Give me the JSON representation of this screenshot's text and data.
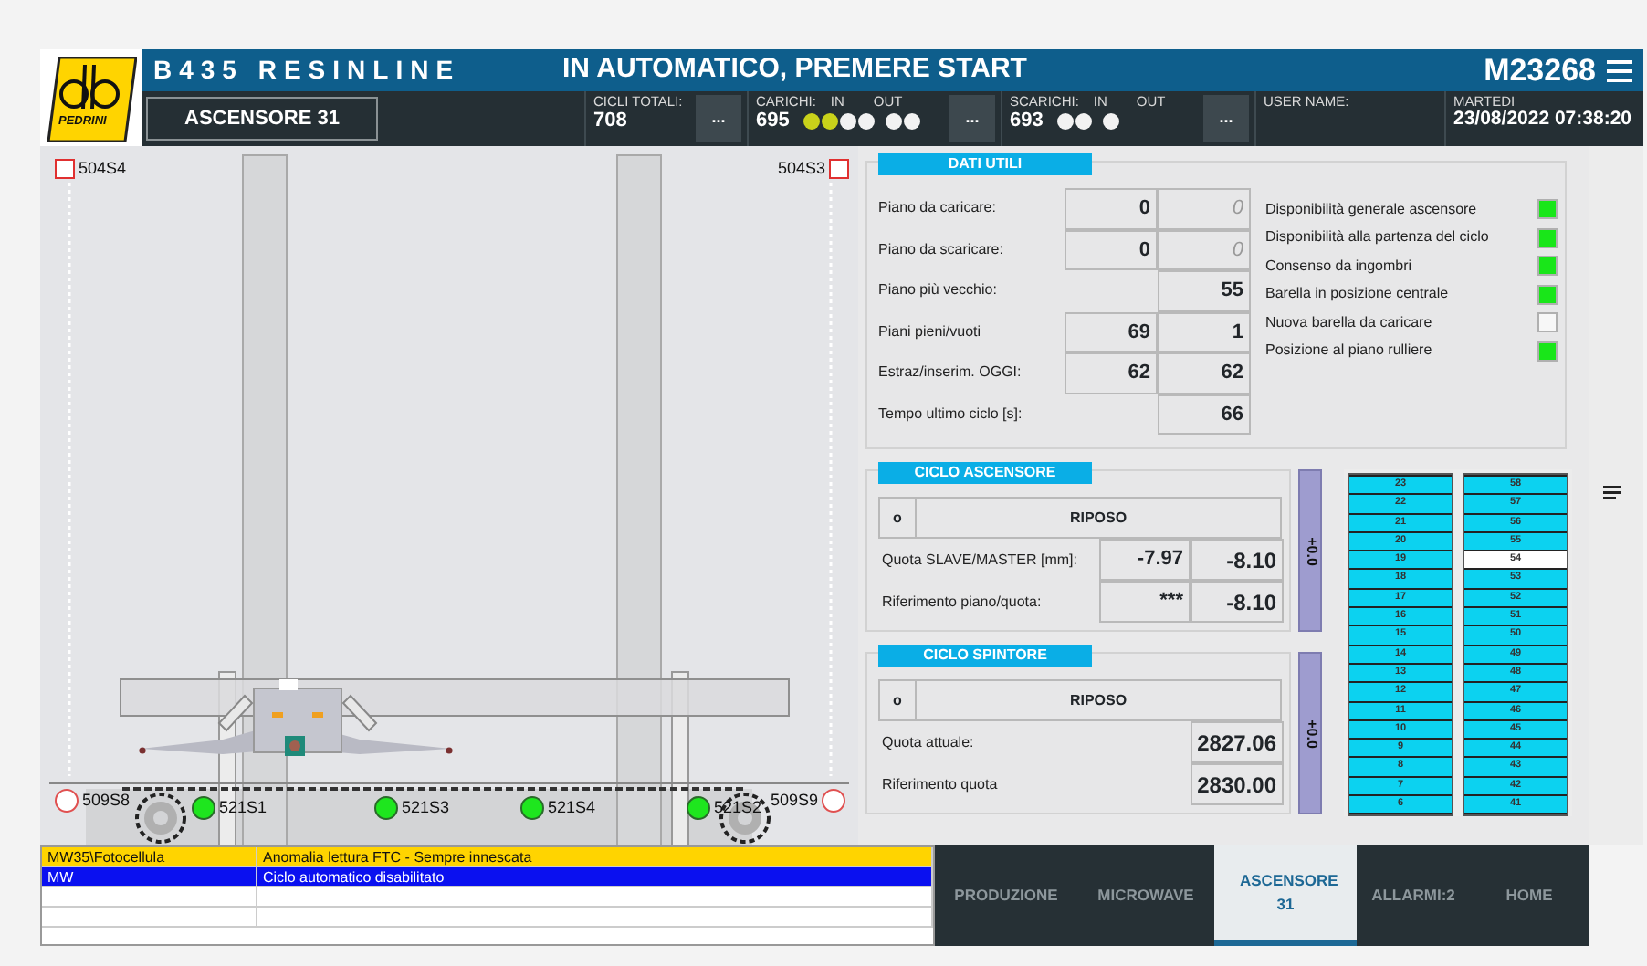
{
  "header": {
    "line_name": "B435 RESINLINE",
    "status": "IN AUTOMATICO, PREMERE START",
    "machine_code": "M23268",
    "logo_text": "PEDRINI",
    "page_button": "ASCENSORE 31"
  },
  "counters": [
    {
      "label": "CICLI TOTALI:",
      "value": "708",
      "more": "..."
    },
    {
      "label": "CARICHI:",
      "value": "695",
      "in_label": "IN",
      "out_label": "OUT",
      "in_dots": [
        {
          "lit": true
        },
        {
          "lit": true
        },
        {
          "lit": false
        },
        {
          "lit": false
        }
      ],
      "out_dots": [
        {
          "lit": false
        },
        {
          "lit": false
        }
      ],
      "more": "..."
    },
    {
      "label": "SCARICHI:",
      "value": "693",
      "in_label": "IN",
      "out_label": "OUT",
      "in_dots": [
        {
          "lit": false
        },
        {
          "lit": false
        }
      ],
      "out_dots": [
        {
          "lit": false
        }
      ],
      "more": "..."
    }
  ],
  "user": {
    "label": "USER NAME:"
  },
  "clock": {
    "day": "MARTEDI",
    "datetime": "23/08/2022 07:38:20"
  },
  "sensors": [
    {
      "label": "504S4",
      "kind": "square",
      "active": false
    },
    {
      "label": "504S3",
      "kind": "square",
      "active": false
    },
    {
      "label": "509S8",
      "kind": "circle",
      "active": false
    },
    {
      "label": "521S1",
      "kind": "circle",
      "active": true
    },
    {
      "label": "521S3",
      "kind": "circle",
      "active": true
    },
    {
      "label": "521S4",
      "kind": "circle",
      "active": true
    },
    {
      "label": "521S2",
      "kind": "circle",
      "active": true
    },
    {
      "label": "509S9",
      "kind": "circle",
      "active": false
    }
  ],
  "dati_utili": {
    "title": "DATI UTILI",
    "rows": [
      {
        "label": "Piano da caricare:",
        "value_1": "0",
        "value_2": "0",
        "dimmed": true
      },
      {
        "label": "Piano da scaricare:",
        "value_1": "0",
        "value_2": "0",
        "dimmed": true
      },
      {
        "label": "Piano più vecchio:",
        "value_2": "55",
        "dimmed": false
      },
      {
        "label": "Piani pieni/vuoti",
        "value_1": "69",
        "value_2": "1",
        "dimmed": false
      },
      {
        "label": "Estraz/inserim. OGGI:",
        "value_1": "62",
        "value_2": "62",
        "dimmed": false
      },
      {
        "label": "Tempo ultimo ciclo [s]:",
        "value_2": "66",
        "dimmed": false
      }
    ],
    "indicators": [
      {
        "label": "Disponibilità generale ascensore",
        "on": true
      },
      {
        "label": "Disponibilità alla partenza del ciclo",
        "on": true
      },
      {
        "label": "Consenso da ingombri",
        "on": true
      },
      {
        "label": "Barella in posizione centrale",
        "on": true
      },
      {
        "label": "Nuova barella da caricare",
        "on": false
      },
      {
        "label": "Posizione al piano rulliere",
        "on": true
      }
    ]
  },
  "cycles": [
    {
      "title": "CICLO ASCENSORE",
      "step": "o",
      "state": "RIPOSO",
      "side_button": "+0.0",
      "rows": [
        {
          "label": "Quota SLAVE/MASTER [mm]:",
          "value_1": "-7.97",
          "value_2": "-8.10"
        },
        {
          "label": "Riferimento piano/quota:",
          "value_1": "***",
          "value_2": "-8.10"
        }
      ]
    },
    {
      "title": "CICLO SPINTORE",
      "step": "o",
      "state": "RIPOSO",
      "side_button": "+0.0",
      "rows": [
        {
          "label": "Quota attuale:",
          "value_2": "2827.06"
        },
        {
          "label": "Riferimento quota",
          "value_2": "2830.00"
        }
      ]
    }
  ],
  "floors": [
    [
      {
        "label": "23",
        "selected": false
      },
      {
        "label": "22",
        "selected": false
      },
      {
        "label": "21",
        "selected": false
      },
      {
        "label": "20",
        "selected": false
      },
      {
        "label": "19",
        "selected": false
      },
      {
        "label": "18",
        "selected": false
      },
      {
        "label": "17",
        "selected": false
      },
      {
        "label": "16",
        "selected": false
      },
      {
        "label": "15",
        "selected": false
      },
      {
        "label": "14",
        "selected": false
      },
      {
        "label": "13",
        "selected": false
      },
      {
        "label": "12",
        "selected": false
      },
      {
        "label": "11",
        "selected": false
      },
      {
        "label": "10",
        "selected": false
      },
      {
        "label": "9",
        "selected": false
      },
      {
        "label": "8",
        "selected": false
      },
      {
        "label": "7",
        "selected": false
      },
      {
        "label": "6",
        "selected": false
      }
    ],
    [
      {
        "label": "58",
        "selected": false
      },
      {
        "label": "57",
        "selected": false
      },
      {
        "label": "56",
        "selected": false
      },
      {
        "label": "55",
        "selected": false
      },
      {
        "label": "54",
        "selected": true
      },
      {
        "label": "53",
        "selected": false
      },
      {
        "label": "52",
        "selected": false
      },
      {
        "label": "51",
        "selected": false
      },
      {
        "label": "50",
        "selected": false
      },
      {
        "label": "49",
        "selected": false
      },
      {
        "label": "48",
        "selected": false
      },
      {
        "label": "47",
        "selected": false
      },
      {
        "label": "46",
        "selected": false
      },
      {
        "label": "45",
        "selected": false
      },
      {
        "label": "44",
        "selected": false
      },
      {
        "label": "43",
        "selected": false
      },
      {
        "label": "42",
        "selected": false
      },
      {
        "label": "41",
        "selected": false
      }
    ]
  ],
  "alarms": [
    {
      "source": "MW35\\Fotocellula",
      "message": "Anomalia lettura FTC - Sempre innescata",
      "kind": "warning"
    },
    {
      "source": "MW",
      "message": "Ciclo automatico disabilitato",
      "kind": "info"
    }
  ],
  "tabs": [
    {
      "label": "PRODUZIONE",
      "selected": false
    },
    {
      "label": "MICROWAVE",
      "selected": false
    },
    {
      "label": "ASCENSORE 31",
      "selected": true
    },
    {
      "label": "ALLARMI:2",
      "selected": false
    },
    {
      "label": "HOME",
      "selected": false
    }
  ]
}
